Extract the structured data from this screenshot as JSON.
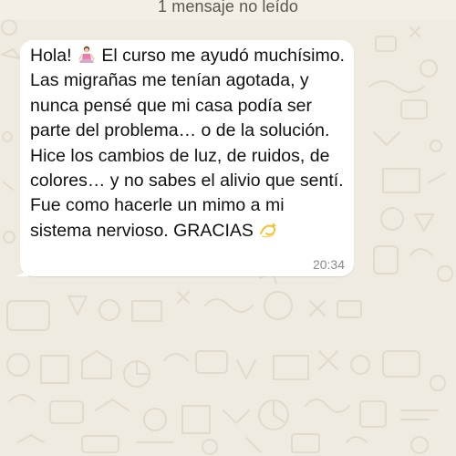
{
  "banner": {
    "text": "1 mensaje no leído"
  },
  "message": {
    "part_hello": "Hola! ",
    "part_body_1": " El curso me ayudó muchísimo. Las migrañas me tenían agotada, y nunca pensé que mi casa podía ser parte del problema… o de la solución. Hice los cambios de luz, de ruidos, de colores… y no sabes el alivio que sentí. Fue como hacerle un mimo a mi sistema nervioso. GRACIAS ",
    "emoji_1": "person-in-lotus-position-emoji",
    "emoji_2": "dizzy-emoji",
    "time": "20:34"
  },
  "colors": {
    "wallpaper": "#f0ebe1",
    "doodle": "#e2dccf",
    "bubble": "#ffffff",
    "text": "#111111",
    "timestamp": "#8a8a8a"
  }
}
